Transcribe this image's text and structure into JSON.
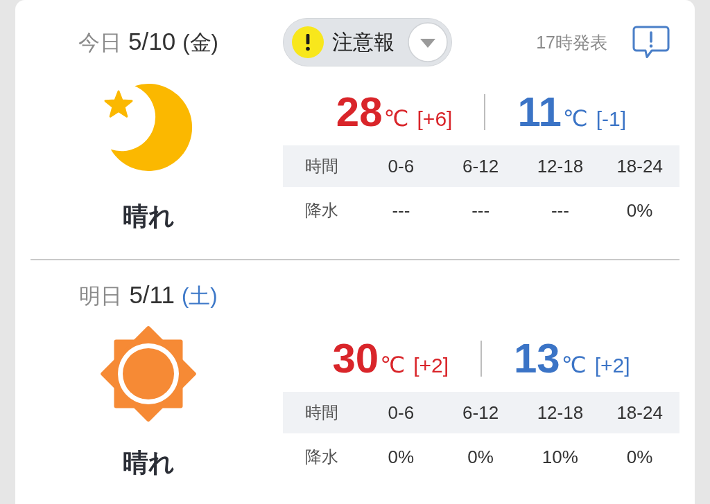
{
  "days": [
    {
      "label": "今日",
      "date": "5/10",
      "weekday": {
        "text": "(金)",
        "color": "#333333"
      },
      "warning": {
        "label": "注意報"
      },
      "issued": "17時発表",
      "kind": "moon",
      "weather": "晴れ",
      "high": {
        "value": "28",
        "unit": "℃",
        "diff": "[+6]"
      },
      "low": {
        "value": "11",
        "unit": "℃",
        "diff": "[-1]"
      },
      "table": {
        "header": "時間",
        "slots": [
          "0-6",
          "6-12",
          "12-18",
          "18-24"
        ],
        "rows": [
          {
            "label": "降水",
            "values": [
              "---",
              "---",
              "---",
              "0%"
            ]
          }
        ]
      }
    },
    {
      "label": "明日",
      "date": "5/11",
      "weekday": {
        "text": "(土)",
        "color": "#3d78c8"
      },
      "kind": "sun",
      "weather": "晴れ",
      "high": {
        "value": "30",
        "unit": "℃",
        "diff": "[+2]"
      },
      "low": {
        "value": "13",
        "unit": "℃",
        "diff": "[+2]"
      },
      "table": {
        "header": "時間",
        "slots": [
          "0-6",
          "6-12",
          "12-18",
          "18-24"
        ],
        "rows": [
          {
            "label": "降水",
            "values": [
              "0%",
              "0%",
              "10%",
              "0%"
            ]
          }
        ]
      }
    }
  ]
}
